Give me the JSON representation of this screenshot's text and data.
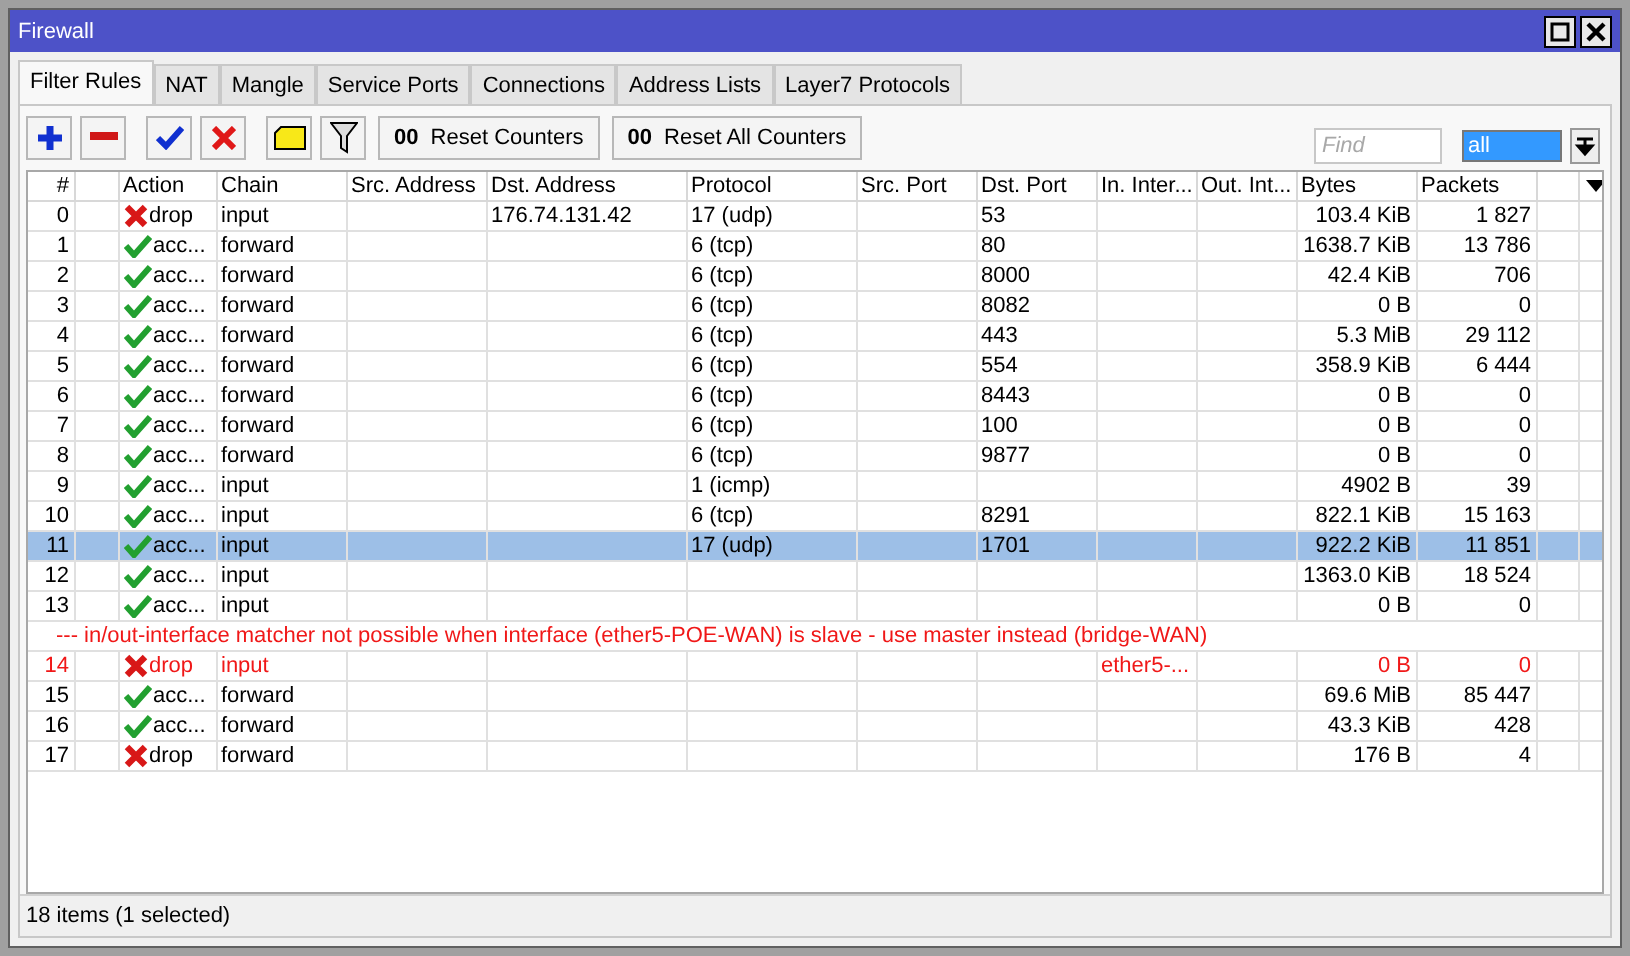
{
  "window": {
    "title": "Firewall"
  },
  "tabs": [
    {
      "label": "Filter Rules",
      "selected": true
    },
    {
      "label": "NAT",
      "selected": false
    },
    {
      "label": "Mangle",
      "selected": false
    },
    {
      "label": "Service Ports",
      "selected": false
    },
    {
      "label": "Connections",
      "selected": false
    },
    {
      "label": "Address Lists",
      "selected": false
    },
    {
      "label": "Layer7 Protocols",
      "selected": false
    }
  ],
  "toolbar": {
    "icon_buttons": [
      {
        "kind": "add"
      },
      {
        "kind": "remove"
      },
      {
        "kind": "enable"
      },
      {
        "kind": "disable"
      },
      {
        "kind": "comment"
      },
      {
        "kind": "filter"
      }
    ],
    "text_buttons": [
      {
        "glyph": "00",
        "label": "Reset Counters"
      },
      {
        "glyph": "00",
        "label": "Reset All Counters"
      }
    ],
    "find": {
      "placeholder": "Find"
    },
    "scope": {
      "value": "all"
    }
  },
  "columns": [
    "#",
    "",
    "Action",
    "Chain",
    "Src. Address",
    "Dst. Address",
    "Protocol",
    "Src. Port",
    "Dst. Port",
    "In. Inter...",
    "Out. Int...",
    "Bytes",
    "Packets"
  ],
  "rows": [
    {
      "kind": "rule",
      "selected": false,
      "invalid": false,
      "number": "0",
      "action_icon": {
        "kind": "drop"
      },
      "action": "drop",
      "chain": "input",
      "dst_address": "176.74.131.42",
      "protocol": "17 (udp)",
      "dst_port": "53",
      "bytes": "103.4 KiB",
      "packets": "1 827"
    },
    {
      "kind": "rule",
      "selected": false,
      "invalid": false,
      "number": "1",
      "action_icon": {
        "kind": "accept"
      },
      "action": "acc...",
      "chain": "forward",
      "protocol": "6 (tcp)",
      "dst_port": "80",
      "bytes": "1638.7 KiB",
      "packets": "13 786"
    },
    {
      "kind": "rule",
      "selected": false,
      "invalid": false,
      "number": "2",
      "action_icon": {
        "kind": "accept"
      },
      "action": "acc...",
      "chain": "forward",
      "protocol": "6 (tcp)",
      "dst_port": "8000",
      "bytes": "42.4 KiB",
      "packets": "706"
    },
    {
      "kind": "rule",
      "selected": false,
      "invalid": false,
      "number": "3",
      "action_icon": {
        "kind": "accept"
      },
      "action": "acc...",
      "chain": "forward",
      "protocol": "6 (tcp)",
      "dst_port": "8082",
      "bytes": "0 B",
      "packets": "0"
    },
    {
      "kind": "rule",
      "selected": false,
      "invalid": false,
      "number": "4",
      "action_icon": {
        "kind": "accept"
      },
      "action": "acc...",
      "chain": "forward",
      "protocol": "6 (tcp)",
      "dst_port": "443",
      "bytes": "5.3 MiB",
      "packets": "29 112"
    },
    {
      "kind": "rule",
      "selected": false,
      "invalid": false,
      "number": "5",
      "action_icon": {
        "kind": "accept"
      },
      "action": "acc...",
      "chain": "forward",
      "protocol": "6 (tcp)",
      "dst_port": "554",
      "bytes": "358.9 KiB",
      "packets": "6 444"
    },
    {
      "kind": "rule",
      "selected": false,
      "invalid": false,
      "number": "6",
      "action_icon": {
        "kind": "accept"
      },
      "action": "acc...",
      "chain": "forward",
      "protocol": "6 (tcp)",
      "dst_port": "8443",
      "bytes": "0 B",
      "packets": "0"
    },
    {
      "kind": "rule",
      "selected": false,
      "invalid": false,
      "number": "7",
      "action_icon": {
        "kind": "accept"
      },
      "action": "acc...",
      "chain": "forward",
      "protocol": "6 (tcp)",
      "dst_port": "100",
      "bytes": "0 B",
      "packets": "0"
    },
    {
      "kind": "rule",
      "selected": false,
      "invalid": false,
      "number": "8",
      "action_icon": {
        "kind": "accept"
      },
      "action": "acc...",
      "chain": "forward",
      "protocol": "6 (tcp)",
      "dst_port": "9877",
      "bytes": "0 B",
      "packets": "0"
    },
    {
      "kind": "rule",
      "selected": false,
      "invalid": false,
      "number": "9",
      "action_icon": {
        "kind": "accept"
      },
      "action": "acc...",
      "chain": "input",
      "protocol": "1 (icmp)",
      "bytes": "4902 B",
      "packets": "39"
    },
    {
      "kind": "rule",
      "selected": false,
      "invalid": false,
      "number": "10",
      "action_icon": {
        "kind": "accept"
      },
      "action": "acc...",
      "chain": "input",
      "protocol": "6 (tcp)",
      "dst_port": "8291",
      "bytes": "822.1 KiB",
      "packets": "15 163"
    },
    {
      "kind": "rule",
      "selected": true,
      "invalid": false,
      "number": "11",
      "action_icon": {
        "kind": "accept"
      },
      "action": "acc...",
      "chain": "input",
      "protocol": "17 (udp)",
      "dst_port": "1701",
      "bytes": "922.2 KiB",
      "packets": "11 851"
    },
    {
      "kind": "rule",
      "selected": false,
      "invalid": false,
      "number": "12",
      "action_icon": {
        "kind": "accept"
      },
      "action": "acc...",
      "chain": "input",
      "bytes": "1363.0 KiB",
      "packets": "18 524"
    },
    {
      "kind": "rule",
      "selected": false,
      "invalid": false,
      "number": "13",
      "action_icon": {
        "kind": "accept"
      },
      "action": "acc...",
      "chain": "input",
      "bytes": "0 B",
      "packets": "0"
    },
    {
      "kind": "comment",
      "text": "--- in/out-interface matcher not possible when interface (ether5-POE-WAN) is slave - use master instead (bridge-WAN)"
    },
    {
      "kind": "rule",
      "selected": false,
      "invalid": true,
      "number": "14",
      "action_icon": {
        "kind": "drop"
      },
      "action": "drop",
      "chain": "input",
      "in_interface": "ether5-...",
      "bytes": "0 B",
      "packets": "0"
    },
    {
      "kind": "rule",
      "selected": false,
      "invalid": false,
      "number": "15",
      "action_icon": {
        "kind": "accept"
      },
      "action": "acc...",
      "chain": "forward",
      "bytes": "69.6 MiB",
      "packets": "85 447"
    },
    {
      "kind": "rule",
      "selected": false,
      "invalid": false,
      "number": "16",
      "action_icon": {
        "kind": "accept"
      },
      "action": "acc...",
      "chain": "forward",
      "bytes": "43.3 KiB",
      "packets": "428"
    },
    {
      "kind": "rule",
      "selected": false,
      "invalid": false,
      "number": "17",
      "action_icon": {
        "kind": "drop"
      },
      "action": "drop",
      "chain": "forward",
      "bytes": "176 B",
      "packets": "4"
    }
  ],
  "status_bar": "18 items (1 selected)"
}
